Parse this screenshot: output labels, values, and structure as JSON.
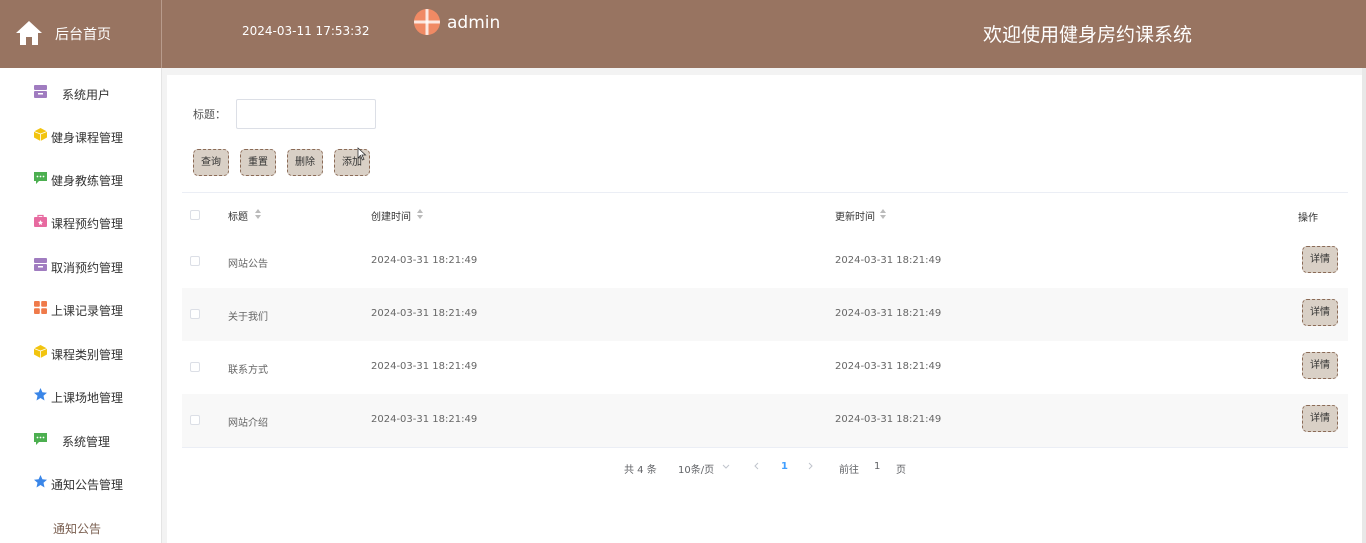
{
  "header": {
    "home_label": "后台首页",
    "datetime": "2024-03-11 17:53:32",
    "username": "admin",
    "welcome": "欢迎使用健身房约课系统",
    "color": "#987461"
  },
  "sidebar": {
    "items": [
      {
        "label": "系统用户",
        "icon": "archive-icon",
        "color": "#a07cc0"
      },
      {
        "label": "健身课程管理",
        "icon": "cube-icon",
        "color": "#f2c40f"
      },
      {
        "label": "健身教练管理",
        "icon": "chat-icon",
        "color": "#4caf50"
      },
      {
        "label": "课程预约管理",
        "icon": "bag-icon",
        "color": "#e76aa0"
      },
      {
        "label": "取消预约管理",
        "icon": "archive-icon",
        "color": "#a07cc0"
      },
      {
        "label": "上课记录管理",
        "icon": "grid-icon",
        "color": "#ef7a4a"
      },
      {
        "label": "课程类别管理",
        "icon": "cube-icon",
        "color": "#f2c40f"
      },
      {
        "label": "上课场地管理",
        "icon": "star-icon",
        "color": "#3a86e8"
      },
      {
        "label": "系统管理",
        "icon": "chat-icon",
        "color": "#4caf50"
      },
      {
        "label": "通知公告管理",
        "icon": "star-icon",
        "color": "#3a86e8"
      }
    ],
    "sub_item": "通知公告"
  },
  "search": {
    "label": "标题：",
    "value": "",
    "placeholder": ""
  },
  "buttons": {
    "query": "查询",
    "reset": "重置",
    "delete": "删除",
    "add": "添加"
  },
  "table": {
    "columns": [
      "标题",
      "创建时间",
      "更新时间",
      "操作"
    ],
    "rows": [
      {
        "title": "网站公告",
        "created": "2024-03-31 18:21:49",
        "updated": "2024-03-31 18:21:49",
        "action": "详情"
      },
      {
        "title": "关于我们",
        "created": "2024-03-31 18:21:49",
        "updated": "2024-03-31 18:21:49",
        "action": "详情"
      },
      {
        "title": "联系方式",
        "created": "2024-03-31 18:21:49",
        "updated": "2024-03-31 18:21:49",
        "action": "详情"
      },
      {
        "title": "网站介绍",
        "created": "2024-03-31 18:21:49",
        "updated": "2024-03-31 18:21:49",
        "action": "详情"
      }
    ]
  },
  "pagination": {
    "total": "共 4 条",
    "page_size": "10条/页",
    "current": "1",
    "goto_prefix": "前往",
    "goto_value": "1",
    "goto_suffix": "页",
    "active_color": "#409eff"
  }
}
